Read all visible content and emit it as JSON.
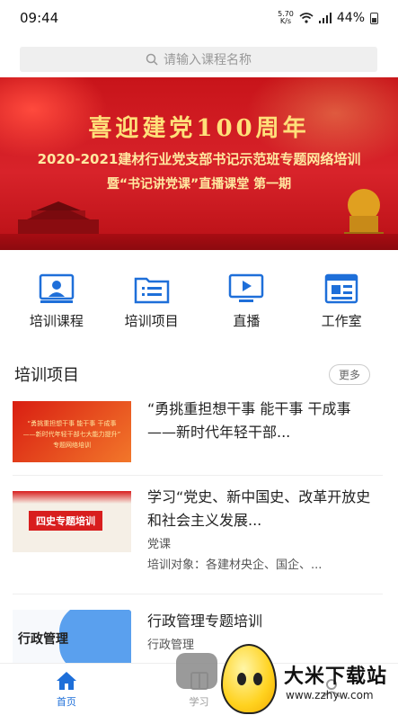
{
  "status_bar": {
    "time": "09:44",
    "net_speed_value": "5.70",
    "net_speed_unit": "K/s",
    "battery": "44%"
  },
  "search": {
    "placeholder": "请输入课程名称"
  },
  "banner": {
    "title": "喜迎建党100周年",
    "line2": "2020-2021建材行业党支部书记示范班专题网络培训",
    "line3": "暨“书记讲党课”直播课堂 第一期"
  },
  "quick_nav": [
    {
      "label": "培训课程",
      "icon": "training-course-icon"
    },
    {
      "label": "培训项目",
      "icon": "training-project-icon"
    },
    {
      "label": "直播",
      "icon": "live-icon"
    },
    {
      "label": "工作室",
      "icon": "studio-icon"
    }
  ],
  "section": {
    "title": "培训项目",
    "more": "更多"
  },
  "items": [
    {
      "title": "“勇挑重担想干事 能干事 干成事 ——新时代年轻干部...",
      "thumb_text_1": "“勇挑重担想干事 能干事 干成事",
      "thumb_text_2": "——新时代年轻干部七大能力提升”",
      "thumb_text_3": "专题网络培训"
    },
    {
      "title": "学习“党史、新中国史、改革开放史和社会主义发展...",
      "sub": "党课",
      "target": "培训对象：各建材央企、国企、...",
      "thumb_label": "四史专题培训"
    },
    {
      "title": "行政管理专题培训",
      "sub": "行政管理",
      "thumb_text": "行政管理"
    }
  ],
  "tabbar": [
    {
      "label": "首页",
      "icon": "home-icon",
      "active": true
    },
    {
      "label": "学习",
      "icon": "book-icon",
      "active": false
    },
    {
      "label": "",
      "icon": "profile-icon",
      "active": false
    }
  ],
  "watermark": {
    "text": "大米下载站",
    "url": "www.zzhyw.com"
  },
  "colors": {
    "accent": "#1e6fd9",
    "banner_red": "#d8232a",
    "banner_gold": "#ffe07a"
  }
}
